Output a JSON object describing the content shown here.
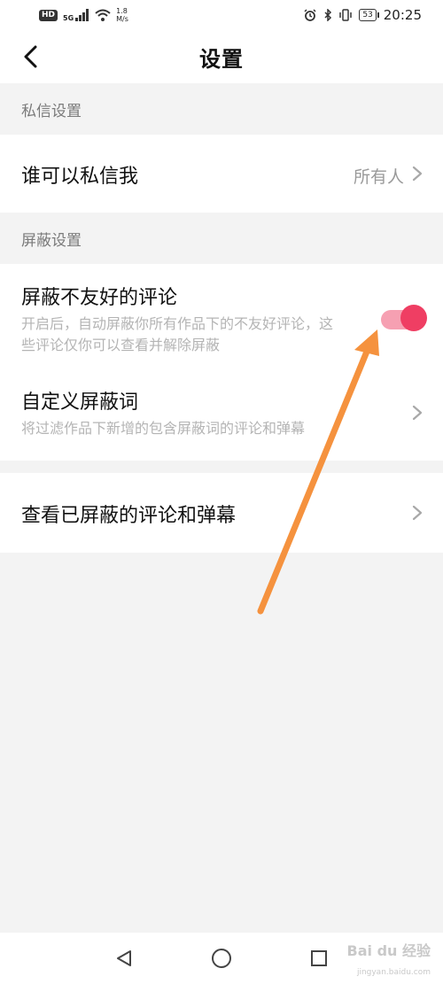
{
  "status_bar": {
    "hd_badge": "HD",
    "network": "5G",
    "speed_value": "1.8",
    "speed_unit": "M/s",
    "battery": "53",
    "time": "20:25"
  },
  "header": {
    "title": "设置"
  },
  "sections": {
    "private_message": {
      "header": "私信设置",
      "who_can_message_label": "谁可以私信我",
      "who_can_message_value": "所有人"
    },
    "block": {
      "header": "屏蔽设置",
      "block_unfriendly_label": "屏蔽不友好的评论",
      "block_unfriendly_desc": "开启后，自动屏蔽你所有作品下的不友好评论，这些评论仅你可以查看并解除屏蔽",
      "block_unfriendly_enabled": true,
      "custom_words_label": "自定义屏蔽词",
      "custom_words_desc": "将过滤作品下新增的包含屏蔽词的评论和弹幕",
      "view_blocked_label": "查看已屏蔽的评论和弹幕"
    }
  },
  "colors": {
    "accent": "#ef3e63",
    "toggle_track": "#f6a0b2",
    "arrow": "#f5923e"
  },
  "watermark": {
    "brand": "Bai du 经验",
    "url": "jingyan.baidu.com"
  }
}
